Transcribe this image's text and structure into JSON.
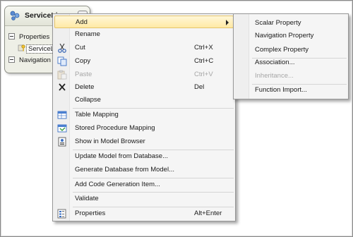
{
  "entity": {
    "title": "ServiceLi",
    "section_properties": "Properties",
    "property_item": "ServiceLi",
    "section_navigation": "Navigation P"
  },
  "context_menu": {
    "items": [
      {
        "label": "Add",
        "shortcut": "",
        "icon": "",
        "disabled": false,
        "highlighted": true,
        "has_submenu": true
      },
      {
        "label": "Rename",
        "shortcut": "",
        "icon": "",
        "disabled": false
      },
      {
        "label": "Cut",
        "shortcut": "Ctrl+X",
        "icon": "scissors-icon",
        "disabled": false
      },
      {
        "label": "Copy",
        "shortcut": "Ctrl+C",
        "icon": "copy-icon",
        "disabled": false
      },
      {
        "label": "Paste",
        "shortcut": "Ctrl+V",
        "icon": "paste-icon",
        "disabled": true
      },
      {
        "label": "Delete",
        "shortcut": "Del",
        "icon": "delete-x-icon",
        "disabled": false
      },
      {
        "label": "Collapse",
        "shortcut": "",
        "icon": "",
        "disabled": false
      },
      {
        "label": "Table Mapping",
        "shortcut": "",
        "icon": "table-mapping-icon",
        "disabled": false
      },
      {
        "label": "Stored Procedure Mapping",
        "shortcut": "",
        "icon": "stored-procedure-mapping-icon",
        "disabled": false
      },
      {
        "label": "Show in Model Browser",
        "shortcut": "",
        "icon": "model-browser-icon",
        "disabled": false
      },
      {
        "label": "Update Model from Database...",
        "shortcut": "",
        "icon": "",
        "disabled": false
      },
      {
        "label": "Generate Database from Model...",
        "shortcut": "",
        "icon": "",
        "disabled": false
      },
      {
        "label": "Add Code Generation Item...",
        "shortcut": "",
        "icon": "",
        "disabled": false
      },
      {
        "label": "Validate",
        "shortcut": "",
        "icon": "",
        "disabled": false
      },
      {
        "label": "Properties",
        "shortcut": "Alt+Enter",
        "icon": "properties-icon",
        "disabled": false
      }
    ]
  },
  "add_submenu": {
    "items": [
      {
        "label": "Scalar Property",
        "disabled": false
      },
      {
        "label": "Navigation Property",
        "disabled": false
      },
      {
        "label": "Complex Property",
        "disabled": false
      },
      {
        "label": "Association...",
        "disabled": false
      },
      {
        "label": "Inheritance...",
        "disabled": true
      },
      {
        "label": "Function Import...",
        "disabled": false
      }
    ]
  },
  "colors": {
    "highlight_fill": "#ffe9a4",
    "highlight_border": "#e3c36a",
    "disabled_text": "#a6a6a6",
    "menu_background": "#f5f5f5",
    "entity_background": "#eeefe6"
  }
}
